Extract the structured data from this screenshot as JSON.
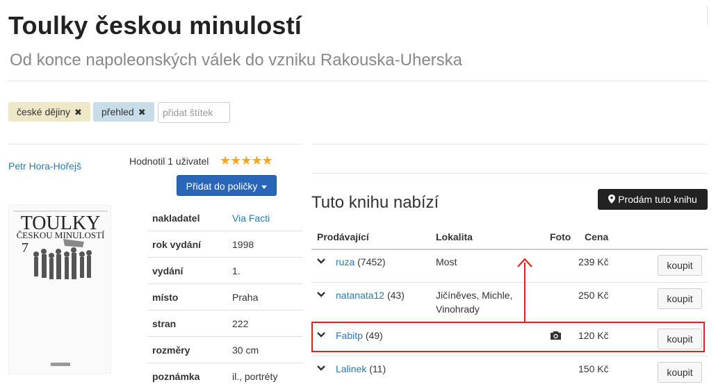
{
  "header": {
    "title": "Toulky českou minulostí",
    "subtitle": "Od konce napoleonských válek do vzniku Rakouska-Uherska"
  },
  "tags": {
    "items": [
      "české dějiny",
      "přehled"
    ],
    "remove_glyph": "✖",
    "colors": [
      "#efe8c8",
      "#c9dde8"
    ],
    "input_placeholder": "přidat štítek"
  },
  "book": {
    "author": "Petr Hora-Hořejš",
    "rating_text": "Hodnotil 1 uživatel",
    "stars": "★★★★★",
    "add_button": "Přidat do poličky",
    "cover_title_1": "TOULKY",
    "cover_title_2": "ČESKOU MINULOSTÍ",
    "cover_number": "7",
    "details": [
      {
        "key": "nakladatel",
        "value": "Via Facti"
      },
      {
        "key": "rok vydání",
        "value": "1998"
      },
      {
        "key": "vydání",
        "value": "1."
      },
      {
        "key": "místo",
        "value": "Praha"
      },
      {
        "key": "stran",
        "value": "222"
      },
      {
        "key": "rozměry",
        "value": "30 cm"
      },
      {
        "key": "poznámka",
        "value": "il., portréty"
      }
    ]
  },
  "offers": {
    "title": "Tuto knihu nabízí",
    "sell_button": "Prodám tuto knihu",
    "columns": {
      "seller": "Prodávající",
      "location": "Lokalita",
      "photo": "Foto",
      "price": "Cena"
    },
    "buy_label": "koupit",
    "rows": [
      {
        "seller": "ruza",
        "count": "(7452)",
        "location": "Most",
        "location2": "",
        "price": "239 Kč",
        "photo": false
      },
      {
        "seller": "natanata12",
        "count": "(43)",
        "location": "Jičíněves, Michle,",
        "location2": "Vinohrady",
        "price": "250 Kč",
        "photo": false
      },
      {
        "seller": "Fabitp",
        "count": "(49)",
        "location": "",
        "location2": "",
        "price": "120 Kč",
        "photo": true
      },
      {
        "seller": "Lalinek",
        "count": "(11)",
        "location": "",
        "location2": "",
        "price": "150 Kč",
        "photo": false
      }
    ]
  },
  "annotation": {
    "color": "#e0221b"
  }
}
